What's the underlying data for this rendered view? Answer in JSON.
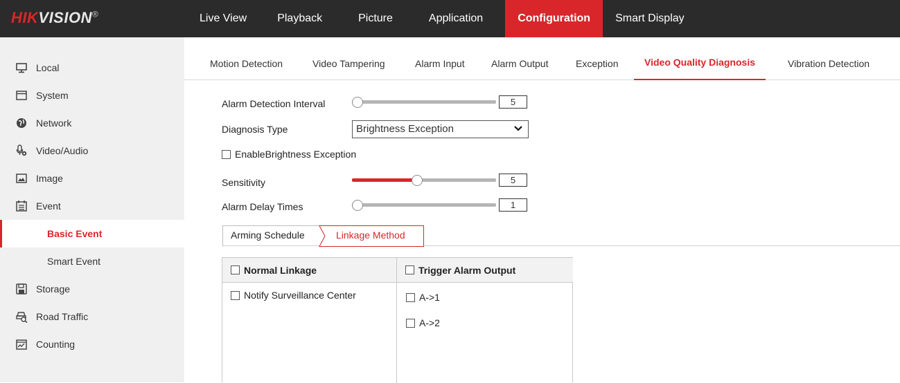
{
  "brand": {
    "logo_red": "HIK",
    "logo_white": "VISION",
    "logo_reg": "®"
  },
  "topnav": [
    {
      "label": "Live View"
    },
    {
      "label": "Playback"
    },
    {
      "label": "Picture"
    },
    {
      "label": "Application"
    },
    {
      "label": "Configuration",
      "active": true
    },
    {
      "label": "Smart Display"
    }
  ],
  "sidebar": {
    "items": [
      {
        "label": "Local",
        "icon": "monitor-icon"
      },
      {
        "label": "System",
        "icon": "window-icon"
      },
      {
        "label": "Network",
        "icon": "globe-icon"
      },
      {
        "label": "Video/Audio",
        "icon": "microphone-icon"
      },
      {
        "label": "Image",
        "icon": "image-icon"
      },
      {
        "label": "Event",
        "icon": "calendar-icon"
      },
      {
        "label": "Basic Event",
        "sub": true,
        "active": true
      },
      {
        "label": "Smart Event",
        "sub": true
      },
      {
        "label": "Storage",
        "icon": "floppy-icon"
      },
      {
        "label": "Road Traffic",
        "icon": "traffic-icon"
      },
      {
        "label": "Counting",
        "icon": "chart-icon"
      }
    ]
  },
  "subtabs": [
    {
      "label": "Motion Detection"
    },
    {
      "label": "Video Tampering"
    },
    {
      "label": "Alarm Input"
    },
    {
      "label": "Alarm Output"
    },
    {
      "label": "Exception"
    },
    {
      "label": "Video Quality Diagnosis",
      "active": true
    },
    {
      "label": "Vibration Detection"
    }
  ],
  "form": {
    "alarm_interval": {
      "label": "Alarm Detection Interval",
      "value": "5",
      "level": 0.0
    },
    "diagnosis_type": {
      "label": "Diagnosis Type",
      "value": "Brightness Exception"
    },
    "enable": {
      "label": "EnableBrightness Exception",
      "checked": false
    },
    "sensitivity": {
      "label": "Sensitivity",
      "value": "5",
      "level": 0.45
    },
    "alarm_delay": {
      "label": "Alarm Delay Times",
      "value": "1",
      "level": 0.0
    }
  },
  "schedule_tabs": [
    {
      "label": "Arming Schedule"
    },
    {
      "label": "Linkage Method",
      "active": true
    }
  ],
  "linkage_table": {
    "col1_header": "Normal Linkage",
    "col2_header": "Trigger Alarm Output",
    "col1_items": [
      {
        "label": "Notify Surveillance Center",
        "checked": false
      }
    ],
    "col2_items": [
      {
        "label": "A->1",
        "checked": false
      },
      {
        "label": "A->2",
        "checked": false
      }
    ]
  },
  "colors": {
    "accent": "#d9262b",
    "topbar": "#2b2b2b",
    "sidebar": "#f0f0f0"
  }
}
